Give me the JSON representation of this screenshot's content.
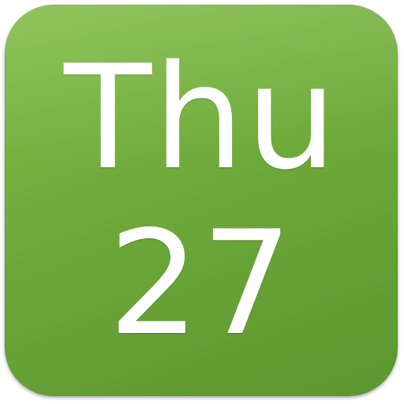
{
  "icon": {
    "day": "Thu",
    "date": "27",
    "background_color": "#6eaa3a",
    "text_color": "#ffffff"
  }
}
